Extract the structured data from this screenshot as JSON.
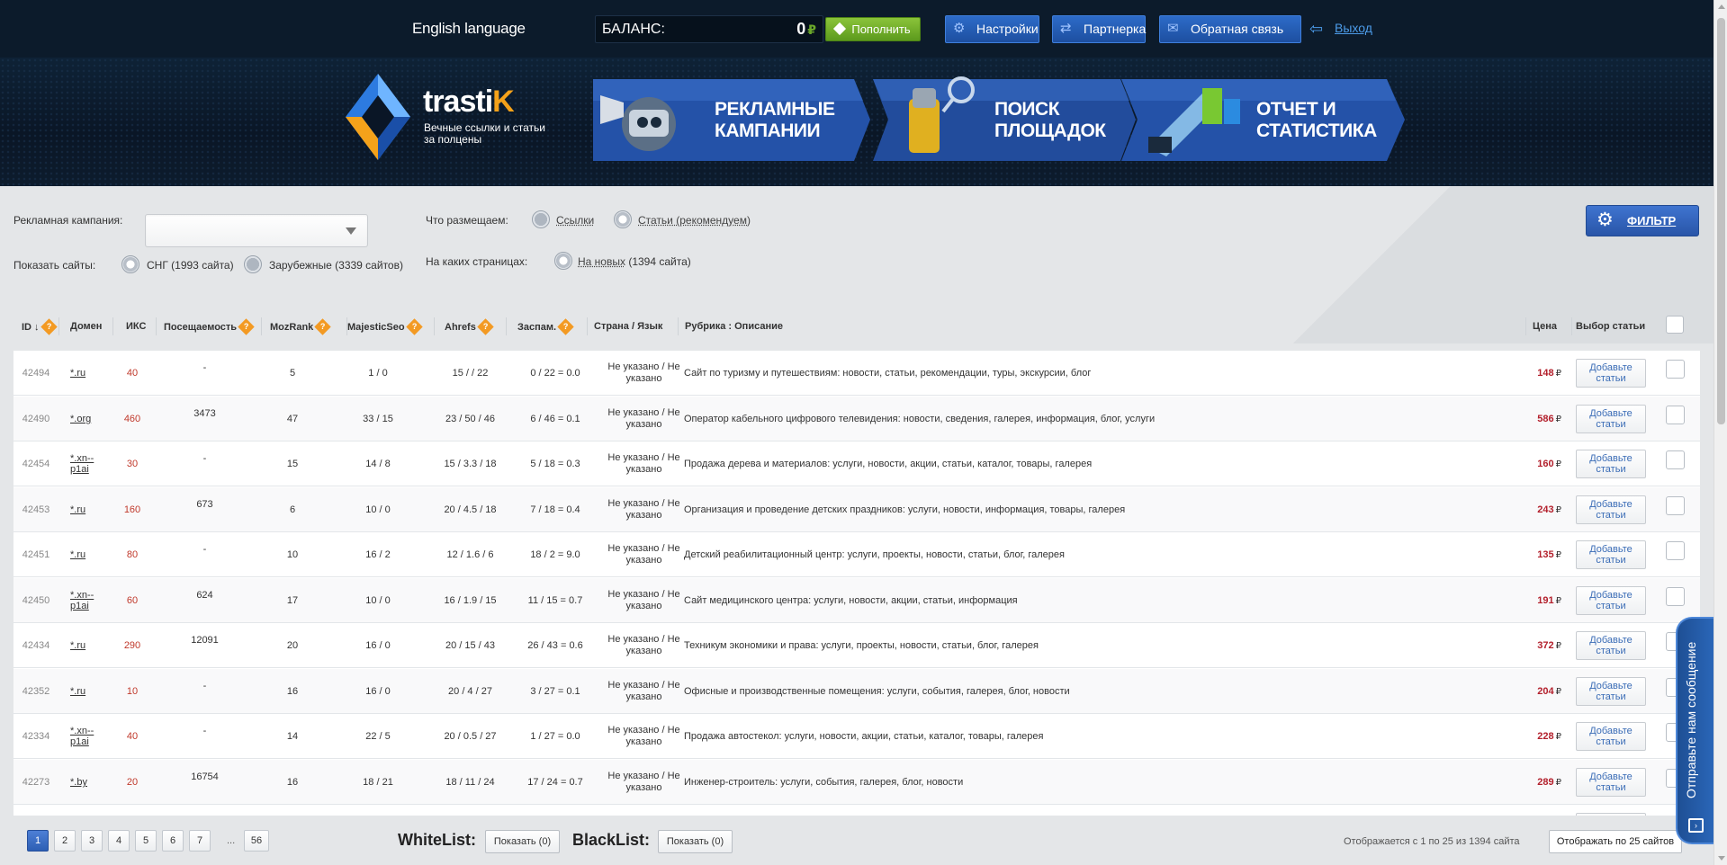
{
  "topbar": {
    "language": "English language",
    "balance_label": "БАЛАНС:",
    "balance_value": "0",
    "currency": "₽",
    "topup_label": "Пополнить",
    "settings_label": "Настройки",
    "partner_label": "Партнерка",
    "feedback_label": "Обратная связь",
    "logout_label": "Выход"
  },
  "banner": {
    "brand_prefix": "trasti",
    "brand_suffix": "K",
    "tagline_line1": "Вечные ссылки и статьи",
    "tagline_line2": "за полцены",
    "promos": [
      {
        "line1": "РЕКЛАМНЫЕ",
        "line2": "КАМПАНИИ"
      },
      {
        "line1": "ПОИСК",
        "line2": "ПЛОЩАДОК"
      },
      {
        "line1": "ОТЧЕТ И",
        "line2": "СТАТИСТИКА"
      }
    ]
  },
  "filters": {
    "campaign_label": "Рекламная кампания:",
    "campaign_value": "",
    "show_sites_label": "Показать сайты:",
    "cis_label": "СНГ (1993 сайта)",
    "foreign_label": "Зарубежные (3339 сайтов)",
    "what_label": "Что размещаем:",
    "links_label": "Ссылки",
    "articles_label": "Статьи (рекомендуем)",
    "pages_label": "На каких страницах:",
    "new_label": "На новых",
    "new_count": "(1394 сайта)",
    "filter_button": "ФИЛЬТР"
  },
  "table": {
    "headers": {
      "id": "ID",
      "domain": "Домен",
      "iks": "ИКС",
      "visits": "Посещаемость",
      "mozrank": "MozRank",
      "majestic": "MajesticSeo",
      "ahrefs": "Ahrefs",
      "spam": "Заспам.",
      "country": "Страна / Язык",
      "rubric": "Рубрика : Описание",
      "price": "Цена",
      "choose": "Выбор статьи"
    },
    "add_button": "Добавьте статьи",
    "rows": [
      {
        "id": "42494",
        "domain": "*.ru",
        "iks": "40",
        "visits": "-",
        "moz": "5",
        "majestic": "1 / 0",
        "ahrefs": "15 / / 22",
        "spam": "0 / 22 = 0.0",
        "country": "Не указано / Не указано",
        "rubric": "Сайт по туризму и путешествиям: новости, статьи, рекомендации, туры, экскурсии, блог",
        "price": "148"
      },
      {
        "id": "42490",
        "domain": "*.org",
        "iks": "460",
        "visits": "3473",
        "moz": "47",
        "majestic": "33 / 15",
        "ahrefs": "23 / 50 / 46",
        "spam": "6 / 46 = 0.1",
        "country": "Не указано / Не указано",
        "rubric": "Оператор кабельного цифрового телевидения: новости, сведения, галерея, информация, блог, услуги",
        "price": "586"
      },
      {
        "id": "42454",
        "domain": "*.xn--p1ai",
        "iks": "30",
        "visits": "-",
        "moz": "15",
        "majestic": "14 / 8",
        "ahrefs": "15 / 3.3 / 18",
        "spam": "5 / 18 = 0.3",
        "country": "Не указано / Не указано",
        "rubric": "Продажа дерева и материалов: услуги, новости, акции, статьи, каталог, товары, галерея",
        "price": "160"
      },
      {
        "id": "42453",
        "domain": "*.ru",
        "iks": "160",
        "visits": "673",
        "moz": "6",
        "majestic": "10 / 0",
        "ahrefs": "20 / 4.5 / 18",
        "spam": "7 / 18 = 0.4",
        "country": "Не указано / Не указано",
        "rubric": "Организация и проведение детских праздников: услуги, новости, информация, товары, галерея",
        "price": "243"
      },
      {
        "id": "42451",
        "domain": "*.ru",
        "iks": "80",
        "visits": "-",
        "moz": "10",
        "majestic": "16 / 2",
        "ahrefs": "12 / 1.6 / 6",
        "spam": "18 / 2 = 9.0",
        "country": "Не указано / Не указано",
        "rubric": "Детский реабилитационный центр: услуги, проекты, новости, статьи, блог, галерея",
        "price": "135"
      },
      {
        "id": "42450",
        "domain": "*.xn--p1ai",
        "iks": "60",
        "visits": "624",
        "moz": "17",
        "majestic": "10 / 0",
        "ahrefs": "16 / 1.9 / 15",
        "spam": "11 / 15 = 0.7",
        "country": "Не указано / Не указано",
        "rubric": "Сайт медицинского центра: услуги, новости, акции, статьи, информация",
        "price": "191"
      },
      {
        "id": "42434",
        "domain": "*.ru",
        "iks": "290",
        "visits": "12091",
        "moz": "20",
        "majestic": "16 / 0",
        "ahrefs": "20 / 15 / 43",
        "spam": "26 / 43 = 0.6",
        "country": "Не указано / Не указано",
        "rubric": "Техникум экономики и права: услуги, проекты, новости, статьи, блог, галерея",
        "price": "372"
      },
      {
        "id": "42352",
        "domain": "*.ru",
        "iks": "10",
        "visits": "-",
        "moz": "16",
        "majestic": "16 / 0",
        "ahrefs": "20 / 4 / 27",
        "spam": "3 / 27 = 0.1",
        "country": "Не указано / Не указано",
        "rubric": "Офисные и производственные помещения: услуги, события, галерея, блог, новости",
        "price": "204"
      },
      {
        "id": "42334",
        "domain": "*.xn--p1ai",
        "iks": "40",
        "visits": "-",
        "moz": "14",
        "majestic": "22 / 5",
        "ahrefs": "20 / 0.5 / 27",
        "spam": "1 / 27 = 0.0",
        "country": "Не указано / Не указано",
        "rubric": "Продажа автостекол: услуги, новости, акции, статьи, каталог, товары, галерея",
        "price": "228"
      },
      {
        "id": "42273",
        "domain": "*.by",
        "iks": "20",
        "visits": "16754",
        "moz": "16",
        "majestic": "18 / 21",
        "ahrefs": "18 / 11 / 24",
        "spam": "17 / 24 = 0.7",
        "country": "Не указано / Не указано",
        "rubric": "Инженер-строитель: услуги, события, галерея, блог, новости",
        "price": "289"
      }
    ]
  },
  "footer": {
    "pages": [
      "1",
      "2",
      "3",
      "4",
      "5",
      "6",
      "7"
    ],
    "ellipsis": "...",
    "last_page": "56",
    "whitelist_label": "WhiteList:",
    "whitelist_button": "Показать (0)",
    "blacklist_label": "BlackList:",
    "blacklist_button": "Показать (0)",
    "showing_text": "Отображается с 1 по 25 из 1394 сайта",
    "per_page_button": "Отображать по 25 сайтов"
  },
  "widget": {
    "chat_label": "Отправьте нам сообщение"
  },
  "colors": {
    "header_bg": "#0c1b2b",
    "accent_blue": "#2d6bc8",
    "topup_green": "#6aa72a",
    "price_red": "#b3202c",
    "iks_red": "#c0392b",
    "help_orange": "#f39a23"
  }
}
